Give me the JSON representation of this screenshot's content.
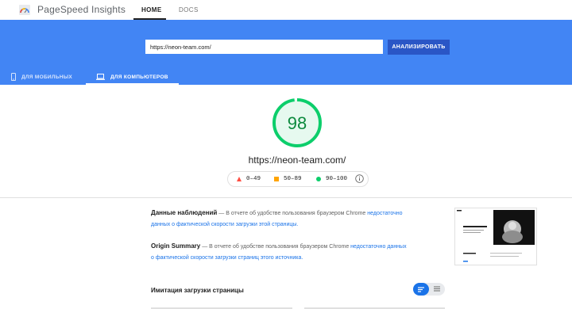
{
  "app": {
    "title": "PageSpeed Insights"
  },
  "nav": {
    "home": "HOME",
    "docs": "DOCS"
  },
  "search": {
    "url": "https://neon-team.com/",
    "button": "АНАЛИЗИРОВАТЬ"
  },
  "tabs": [
    {
      "label": "ДЛЯ МОБИЛЬНЫХ",
      "active": false
    },
    {
      "label": "ДЛЯ КОМПЬЮТЕРОВ",
      "active": true
    }
  ],
  "report": {
    "score": "98",
    "score_fraction": 0.98,
    "url": "https://neon-team.com/",
    "legend": [
      {
        "shape": "triangle",
        "range": "0–49"
      },
      {
        "shape": "square",
        "range": "50–89"
      },
      {
        "shape": "circle",
        "range": "90–100"
      }
    ],
    "colors": {
      "pass": "#0cce6b",
      "average": "#ffa400",
      "fail": "#ff4e42",
      "accent": "#4285f4"
    }
  },
  "field_data": {
    "title": "Данные наблюдений",
    "dash": "—",
    "text": "В отчете об удобстве пользования браузером Chrome",
    "link1": "недостаточно",
    "link2": "данных о фактической скорости загрузки этой страницы."
  },
  "origin_summary": {
    "title": "Origin Summary",
    "dash": "—",
    "text": "В отчете об удобстве пользования браузером Chrome",
    "link1": "недостаточно данных",
    "link2": "о фактической скорости загрузки страниц этого источника."
  },
  "lab": {
    "title": "Имитация загрузки страницы"
  }
}
